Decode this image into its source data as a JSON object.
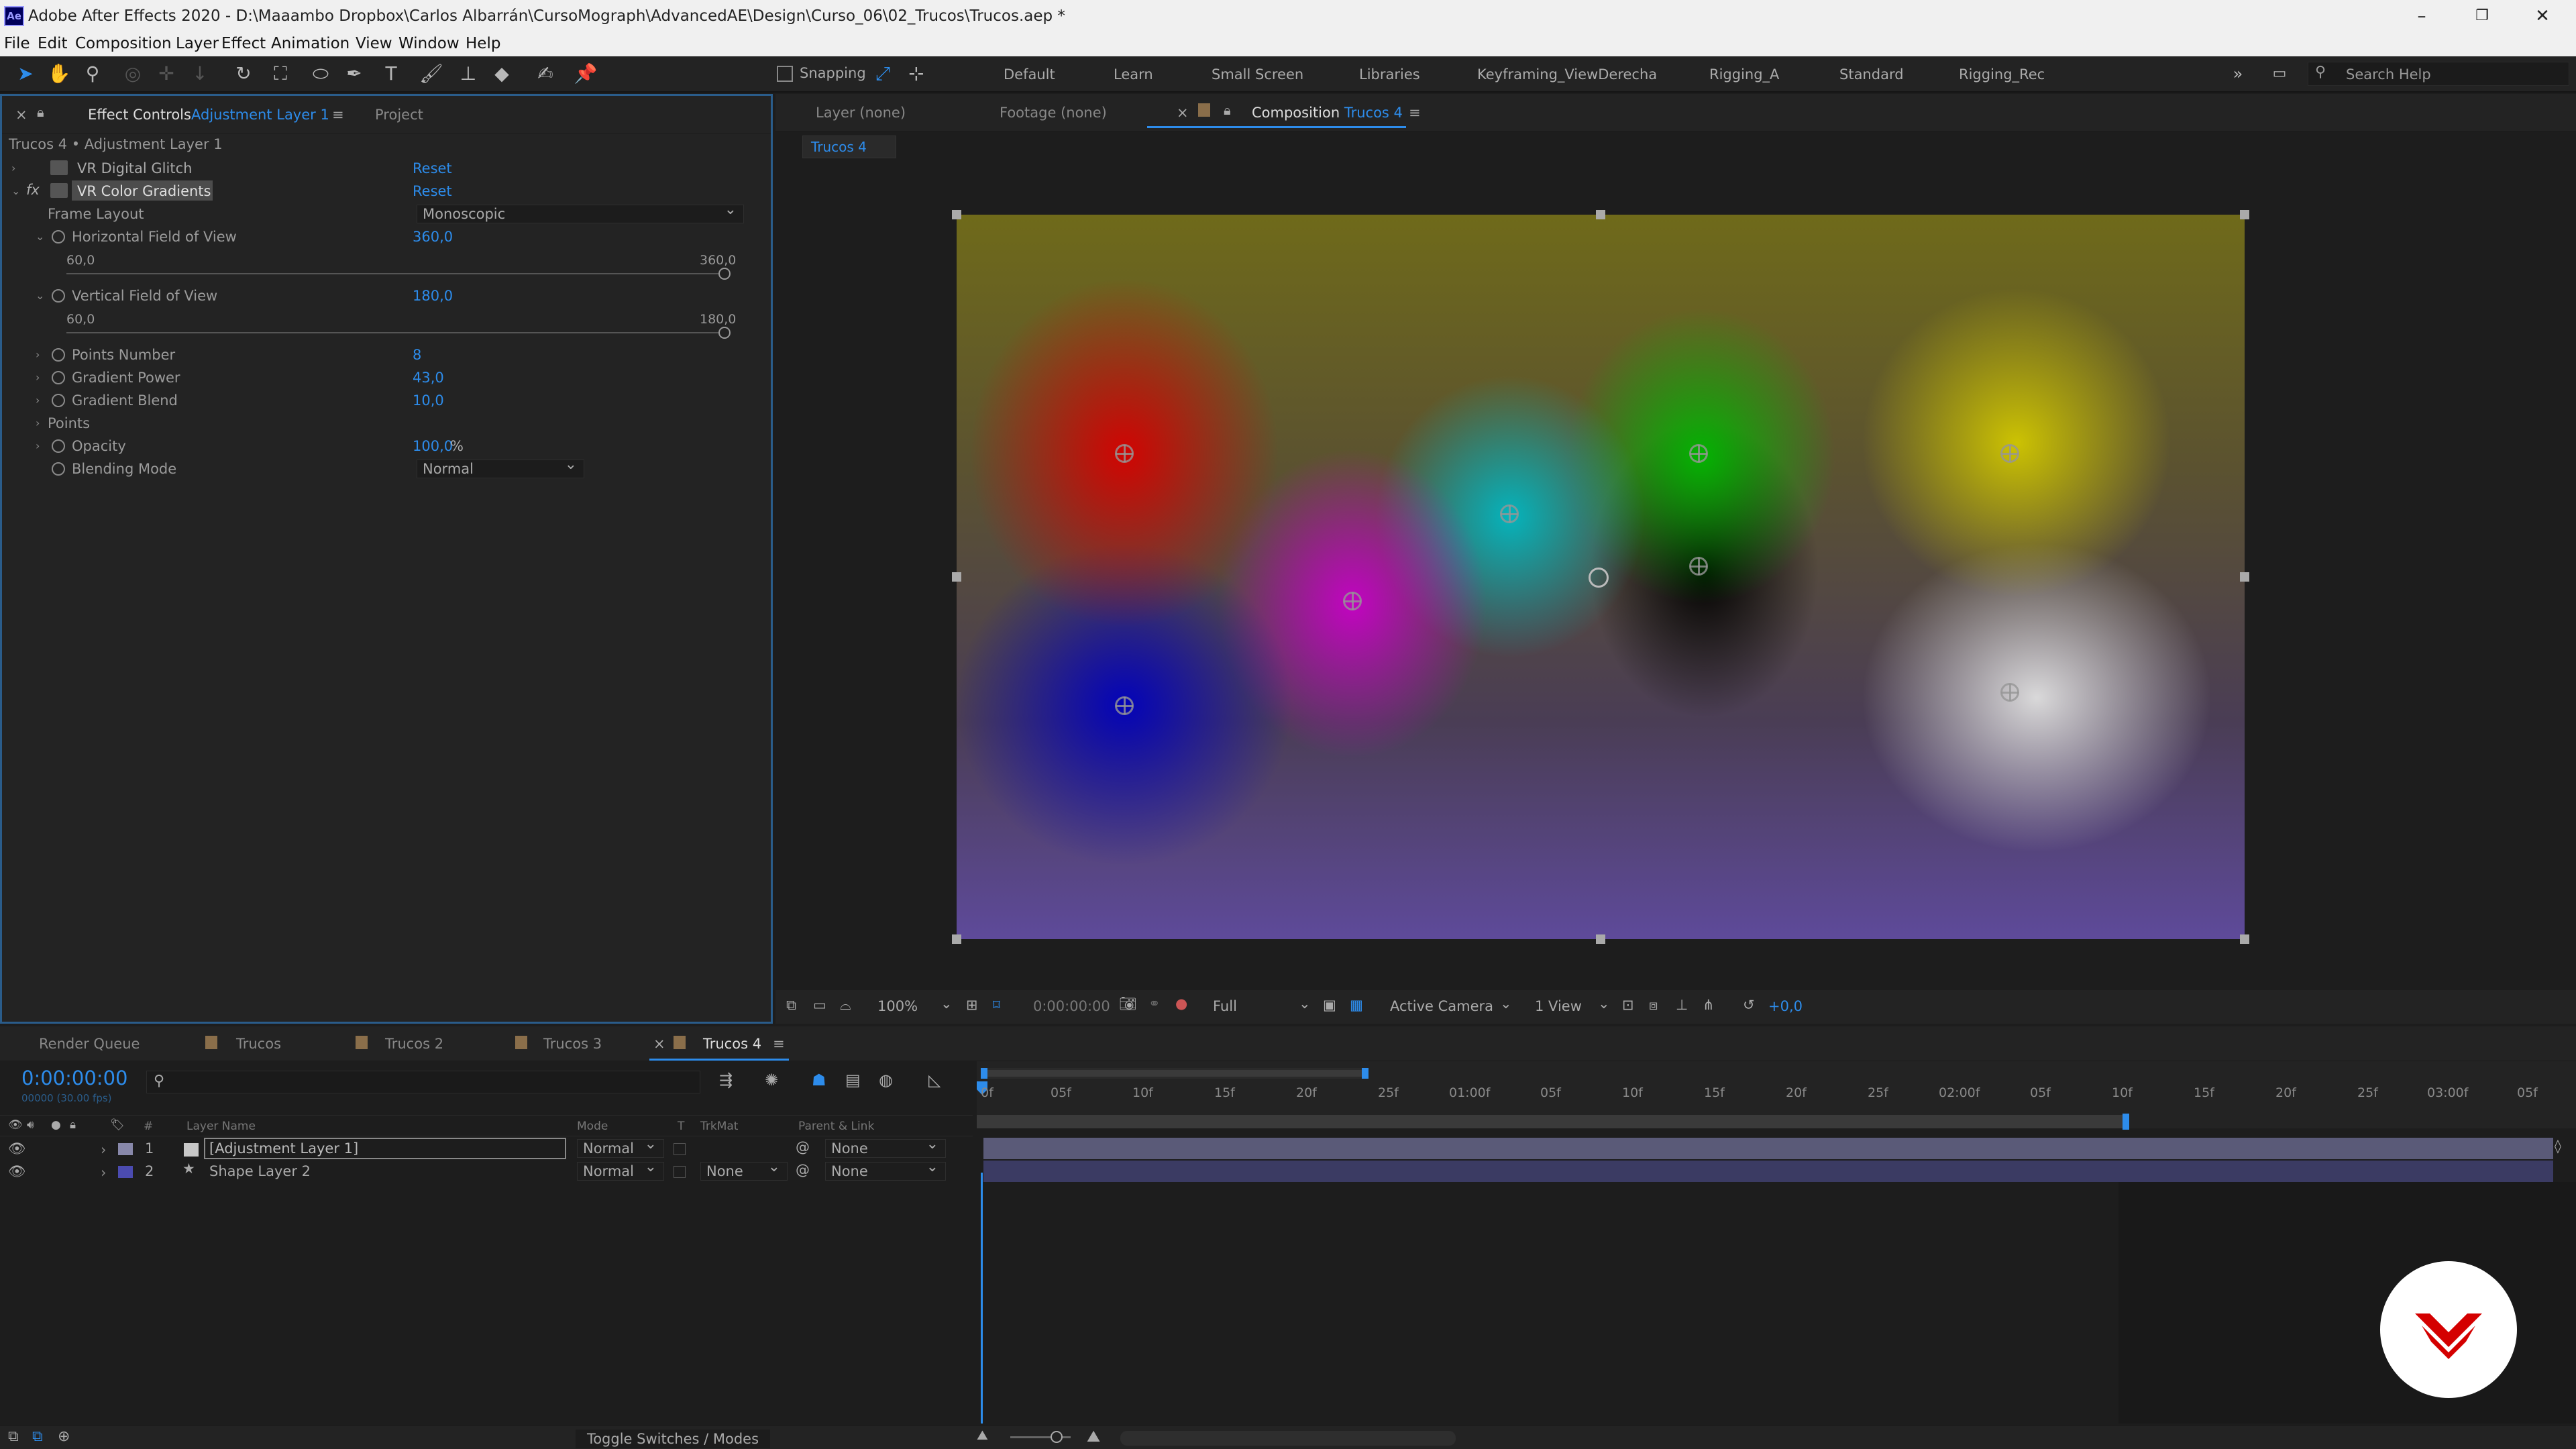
{
  "window": {
    "title": "Adobe After Effects 2020 - D:\\Maaambo Dropbox\\Carlos Albarrán\\CursoMograph\\AdvancedAE\\Design\\Curso_06\\02_Trucos\\Trucos.aep *",
    "app_badge": "Ae"
  },
  "menu": [
    "File",
    "Edit",
    "Composition",
    "Layer",
    "Effect",
    "Animation",
    "View",
    "Window",
    "Help"
  ],
  "toolbar": {
    "snapping": "Snapping",
    "search_placeholder": "Search Help"
  },
  "workspaces": [
    "Default",
    "Learn",
    "Small Screen",
    "Libraries",
    "Keyframing_ViewDerecha",
    "Rigging_A",
    "Standard",
    "Rigging_Rec"
  ],
  "effect_panel": {
    "tab_label": "Effect Controls",
    "tab_layer": "Adjustment Layer 1",
    "project_tab": "Project",
    "breadcrumb": "Trucos 4 • Adjustment Layer 1",
    "effects": [
      {
        "name": "VR Digital Glitch",
        "reset": "Reset"
      },
      {
        "name": "VR Color Gradients",
        "reset": "Reset",
        "fx": "fx"
      }
    ],
    "frame_layout": {
      "label": "Frame Layout",
      "value": "Monoscopic"
    },
    "hfov": {
      "label": "Horizontal Field of View",
      "value": "360,0",
      "min": "60,0",
      "max": "360,0"
    },
    "vfov": {
      "label": "Vertical Field of View",
      "value": "180,0",
      "min": "60,0",
      "max": "180,0"
    },
    "points_number": {
      "label": "Points Number",
      "value": "8"
    },
    "gradient_power": {
      "label": "Gradient Power",
      "value": "43,0"
    },
    "gradient_blend": {
      "label": "Gradient Blend",
      "value": "10,0"
    },
    "points": {
      "label": "Points"
    },
    "opacity": {
      "label": "Opacity",
      "value": "100,0",
      "unit": "%"
    },
    "blending_mode": {
      "label": "Blending Mode",
      "value": "Normal"
    }
  },
  "viewer": {
    "tabs": [
      {
        "label": "Layer",
        "sub": "(none)"
      },
      {
        "label": "Footage",
        "sub": "(none)"
      },
      {
        "label": "Composition",
        "sub": "Trucos 4"
      }
    ],
    "comp_chip": "Trucos 4",
    "zoom": "100%",
    "timecode": "0:00:00:00",
    "resolution": "Full",
    "camera": "Active Camera",
    "views": "1 View",
    "exposure": "+0,0"
  },
  "timeline": {
    "tabs": [
      "Render Queue",
      "Trucos",
      "Trucos 2",
      "Trucos 3",
      "Trucos 4"
    ],
    "current_time": "0:00:00:00",
    "fps": "00000 (30.00 fps)",
    "search_placeholder": "",
    "columns": {
      "num": "#",
      "layer_name": "Layer Name",
      "mode": "Mode",
      "t": "T",
      "trkmat": "TrkMat",
      "parent": "Parent & Link"
    },
    "layers": [
      {
        "num": "1",
        "name": "[Adjustment Layer 1]",
        "mode": "Normal",
        "trkmat": "",
        "parent": "None"
      },
      {
        "num": "2",
        "name": "Shape Layer 2",
        "mode": "Normal",
        "trkmat": "None",
        "parent": "None"
      }
    ],
    "ticks": [
      "0f",
      "05f",
      "10f",
      "15f",
      "20f",
      "25f",
      "01:00f",
      "05f",
      "10f",
      "15f",
      "20f",
      "25f",
      "02:00f",
      "05f",
      "10f",
      "15f",
      "20f",
      "25f",
      "03:00f",
      "05f"
    ],
    "toggle_label": "Toggle Switches / Modes"
  },
  "colors": {
    "accent": "#2d8ceb",
    "layer1_bar": "#5a5a78",
    "layer2_bar": "#3b3b63"
  }
}
